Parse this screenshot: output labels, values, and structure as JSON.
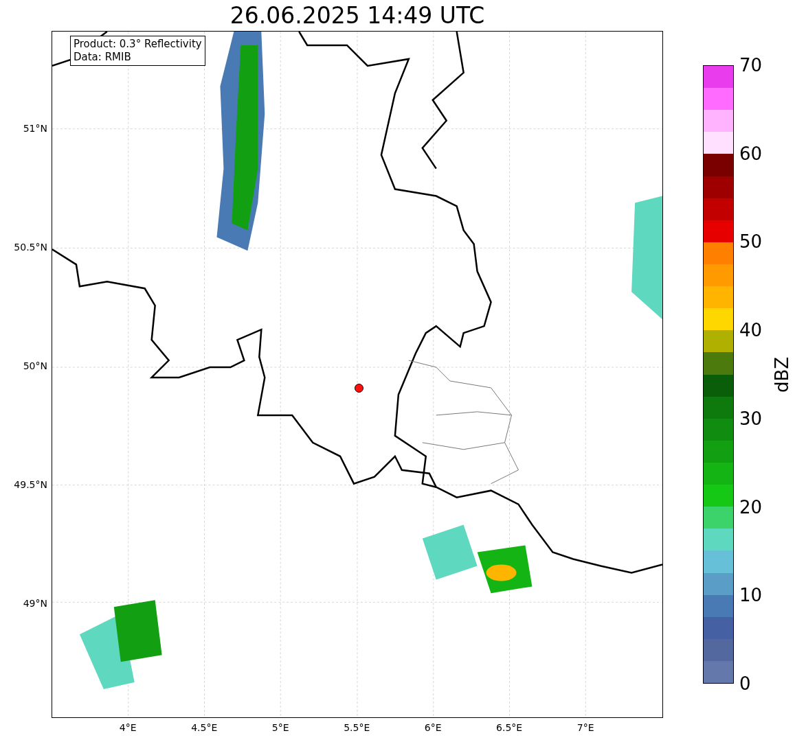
{
  "title": "26.06.2025 14:49 UTC",
  "map": {
    "legend": [
      "Product: 0.3° Reflectivity",
      "Data: RMIB"
    ],
    "lat_ticks": [
      "51°N",
      "50.5°N",
      "50°N",
      "49.5°N",
      "49°N"
    ],
    "lon_ticks": [
      "4°E",
      "4.5°E",
      "5°E",
      "5.5°E",
      "6°E",
      "6.5°E",
      "7°E"
    ]
  },
  "colorbar": {
    "label": "dBZ",
    "ticks": [
      "70",
      "60",
      "50",
      "40",
      "30",
      "20",
      "10",
      "0"
    ],
    "bins": [
      {
        "color": "#e93ced"
      },
      {
        "color": "#ff6bff"
      },
      {
        "color": "#ffb3ff"
      },
      {
        "color": "#ffe1ff"
      },
      {
        "color": "#7a0000"
      },
      {
        "color": "#9e0000"
      },
      {
        "color": "#c20000"
      },
      {
        "color": "#e60000"
      },
      {
        "color": "#ff7f00"
      },
      {
        "color": "#ff9a00"
      },
      {
        "color": "#ffb400"
      },
      {
        "color": "#ffd700"
      },
      {
        "color": "#b0b000"
      },
      {
        "color": "#4c7a0c"
      },
      {
        "color": "#0a5e0a"
      },
      {
        "color": "#0e7a0e"
      },
      {
        "color": "#108c10"
      },
      {
        "color": "#12a012"
      },
      {
        "color": "#14b414"
      },
      {
        "color": "#16c816"
      },
      {
        "color": "#3cd46a"
      },
      {
        "color": "#5fd8c0"
      },
      {
        "color": "#66c0d8"
      },
      {
        "color": "#5a9ec8"
      },
      {
        "color": "#4a7ab4"
      },
      {
        "color": "#4660a4"
      },
      {
        "color": "#5468a0"
      },
      {
        "color": "#6478ac"
      }
    ]
  }
}
